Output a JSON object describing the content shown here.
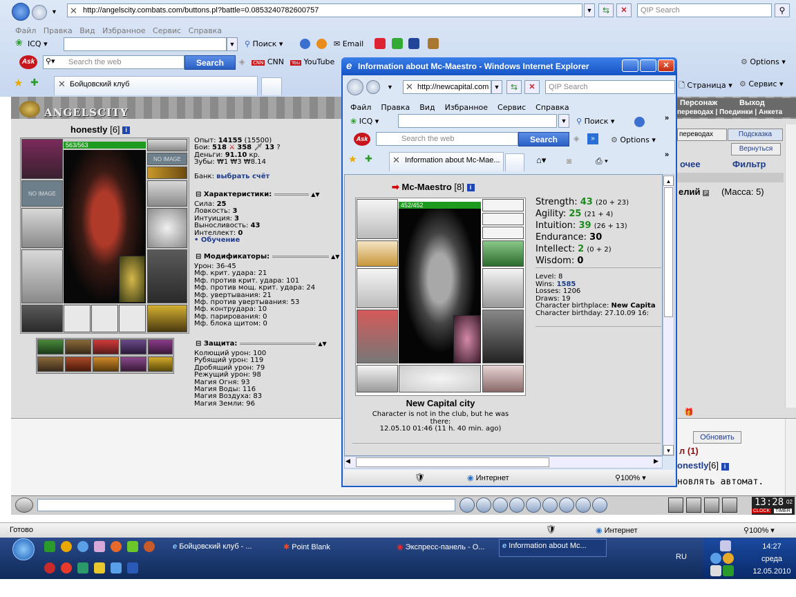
{
  "browser": {
    "url": "http://angelscity.combats.com/buttons.pl?battle=0.0853240782600757",
    "search_placeholder": "QIP Search",
    "menu": [
      "Файл",
      "Правка",
      "Вид",
      "Избранное",
      "Сервис",
      "Справка"
    ],
    "icq_label": "ICQ",
    "search_label": "Поиск",
    "email_label": "Email",
    "ask_placeholder": "Search the web",
    "ask_button": "Search",
    "cnn": "CNN",
    "youtube": "YouTube",
    "options": "Options",
    "tab_title": "Бойцовский клуб",
    "page_label": "Страница",
    "service_label": "Сервис",
    "status": "Готово",
    "zone": "Интернет",
    "zoom": "100%"
  },
  "game": {
    "logo": "ANGELSCITY",
    "top_links": [
      "Персонаж",
      "Выход"
    ],
    "top_links2": [
      "переводах",
      "Поединки",
      "Анкета"
    ],
    "side_buttons": [
      "переводах",
      "Подсказка",
      "Вернуться"
    ],
    "side_headers": [
      "очее",
      "Фильтр"
    ],
    "side_item": "елий",
    "side_mass": "(Масса: 5)",
    "refresh": "Обновить",
    "side_chat1": "л (1)",
    "side_chat2": "onestly",
    "side_chat2_level": "[6]",
    "side_chat3": "новлять автомат.",
    "clock": "13:28",
    "clock_sec": "02",
    "clock_label": "CLOCK",
    "timer_label": "TIMER",
    "player": {
      "name": "honestly",
      "level": "[6]",
      "hp": "563/563",
      "no_image": "NO IMAGE",
      "exp_label": "Опыт:",
      "exp": "14155",
      "exp_next": "(15500)",
      "fights_label": "Бои:",
      "wins": "518",
      "losses": "358",
      "draws": "13",
      "money_label": "Деньги:",
      "money": "91.10",
      "money_unit": "кр.",
      "teeth_label": "Зубы:",
      "teeth": "₩1 ₩3 ₩8.14",
      "bank_label": "Банк:",
      "bank_link": "выбрать счёт",
      "char_header": "Характеристики:",
      "stats": [
        {
          "label": "Сила:",
          "value": "25"
        },
        {
          "label": "Ловкость:",
          "value": "3"
        },
        {
          "label": "Интуиция:",
          "value": "3"
        },
        {
          "label": "Выносливость:",
          "value": "43"
        },
        {
          "label": "Интеллект:",
          "value": "0"
        }
      ],
      "training": "• Обучение",
      "mod_header": "Модификаторы:",
      "mods": [
        "Урон: 36-45",
        "Мф. крит. удара: 21",
        "Мф. против крит. удара: 101",
        "Мф. против мощ. крит. удара: 24",
        "Мф. увертывания: 21",
        "Мф. против увертывания: 53",
        "Мф. контрудара: 10",
        "Мф. парирования: 0",
        "Мф. блока щитом: 0"
      ],
      "def_header": "Защита:",
      "defs": [
        "Колющий урон: 100",
        "Рубящий урон: 119",
        "Дробящий урон: 79",
        "Режущий урон: 98",
        "Магия Огня: 93",
        "Магия Воды: 116",
        "Магия Воздуха: 83",
        "Магия Земли: 96"
      ]
    }
  },
  "popup": {
    "title": "Information about Mc-Maestro - Windows Internet Explorer",
    "url": "http://newcapital.com",
    "search_placeholder": "QIP Search",
    "menu": [
      "Файл",
      "Правка",
      "Вид",
      "Избранное",
      "Сервис",
      "Справка"
    ],
    "icq_label": "ICQ",
    "search_label": "Поиск",
    "ask_placeholder": "Search the web",
    "ask_button": "Search",
    "options": "Options",
    "tab_title": "Information about Mc-Mae...",
    "zone": "Интернет",
    "zoom": "100%",
    "char": {
      "name": "Mc-Maestro",
      "level": "[8]",
      "hp": "452/452",
      "stats": [
        {
          "label": "Strength:",
          "value": "43",
          "extra": "(20 + 23)"
        },
        {
          "label": "Agility:",
          "value": "25",
          "extra": "(21 + 4)"
        },
        {
          "label": "Intuition:",
          "value": "39",
          "extra": "(26 + 13)"
        },
        {
          "label": "Endurance:",
          "value": "30",
          "extra": ""
        },
        {
          "label": "Intellect:",
          "value": "2",
          "extra": "(0 + 2)"
        },
        {
          "label": "Wisdom:",
          "value": "0",
          "extra": ""
        }
      ],
      "level_line": "Level: 8",
      "wins_label": "Wins:",
      "wins": "1585",
      "losses_line": "Losses: 1206",
      "draws_line": "Draws: 19",
      "birthplace_label": "Character birthplace:",
      "birthplace": "New Capita",
      "birthday_line": "Character birthday: 27.10.09 16:",
      "city": "New Capital city",
      "status1": "Character is not in the club, but he was",
      "status2": "there:",
      "status3": "12.05.10 01:46 (11 h. 40 min. ago)"
    }
  },
  "taskbar": {
    "items": [
      "Бойцовский клуб - ...",
      "Point Blank",
      "Экспресс-панель - О...",
      "Information about Mc..."
    ],
    "lang": "RU",
    "time": "14:27",
    "day": "среда",
    "date": "12.05.2010"
  }
}
